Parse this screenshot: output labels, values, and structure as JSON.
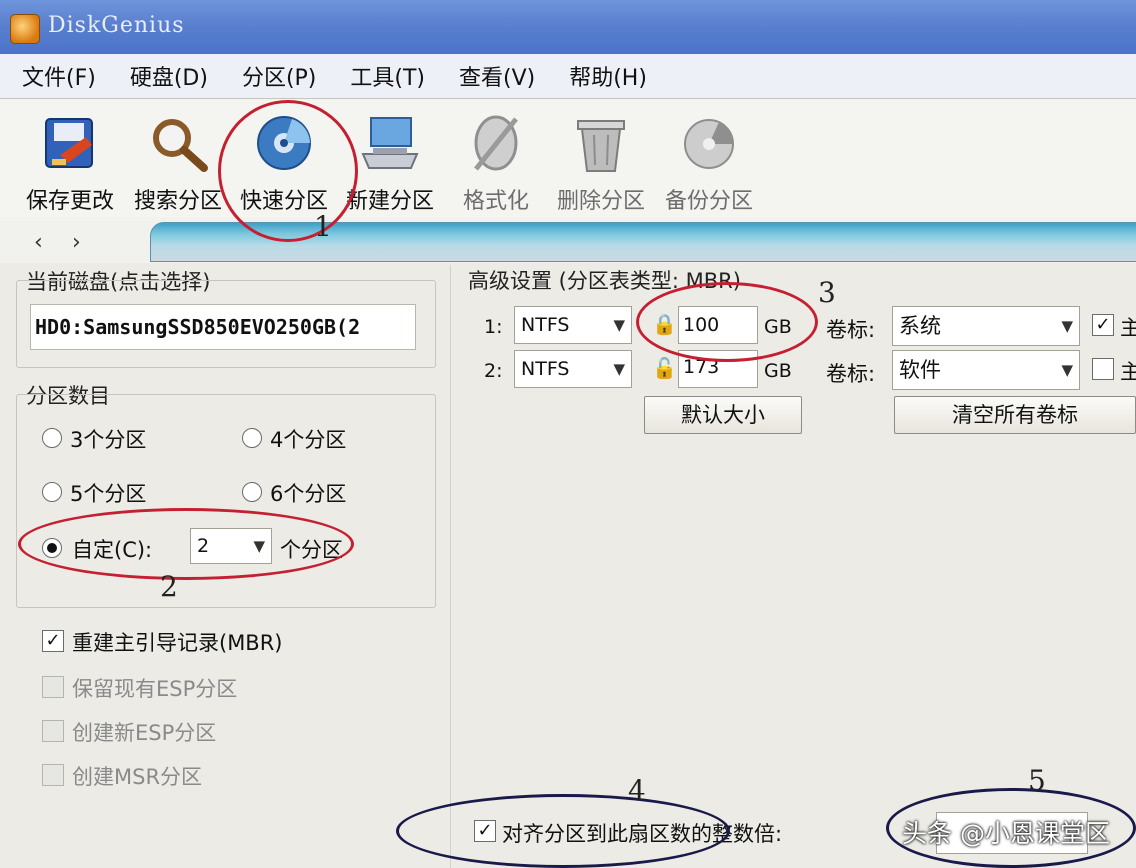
{
  "window": {
    "title": "DiskGenius"
  },
  "menu": [
    {
      "label": "文件(F)"
    },
    {
      "label": "硬盘(D)"
    },
    {
      "label": "分区(P)"
    },
    {
      "label": "工具(T)"
    },
    {
      "label": "查看(V)"
    },
    {
      "label": "帮助(H)"
    }
  ],
  "toolbar": [
    {
      "label": "保存更改",
      "icon": "save-icon"
    },
    {
      "label": "搜索分区",
      "icon": "search-icon"
    },
    {
      "label": "快速分区",
      "icon": "quick-partition-icon"
    },
    {
      "label": "新建分区",
      "icon": "new-partition-icon"
    },
    {
      "label": "格式化",
      "icon": "format-icon"
    },
    {
      "label": "删除分区",
      "icon": "delete-icon"
    },
    {
      "label": "备份分区",
      "icon": "backup-icon"
    }
  ],
  "nav": {
    "back": "‹",
    "forward": "›"
  },
  "left": {
    "disk_group_title": "当前磁盘(点击选择)",
    "disk_value": "HD0:SamsungSSD850EVO250GB(2",
    "count_group_title": "分区数目",
    "radios": [
      {
        "label": "3个分区",
        "checked": false
      },
      {
        "label": "4个分区",
        "checked": false
      },
      {
        "label": "5个分区",
        "checked": false
      },
      {
        "label": "6个分区",
        "checked": false
      }
    ],
    "custom_label": "自定(C):",
    "custom_value": "2",
    "custom_suffix": "个分区",
    "checkboxes": [
      {
        "label": "重建主引导记录(MBR)",
        "checked": true,
        "enabled": true
      },
      {
        "label": "保留现有ESP分区",
        "checked": false,
        "enabled": false
      },
      {
        "label": "创建新ESP分区",
        "checked": false,
        "enabled": false
      },
      {
        "label": "创建MSR分区",
        "checked": false,
        "enabled": false
      }
    ]
  },
  "right": {
    "group_title": "高级设置 (分区表类型: MBR)",
    "rows": [
      {
        "index": "1:",
        "fs": "NTFS",
        "size": "100",
        "unit": "GB",
        "vol_label": "卷标:",
        "volume": "系统",
        "primary_checked": true
      },
      {
        "index": "2:",
        "fs": "NTFS",
        "size": "173",
        "unit": "GB",
        "vol_label": "卷标:",
        "volume": "软件",
        "primary_checked": false
      }
    ],
    "primary_label": "主",
    "default_size_button": "默认大小",
    "clear_labels_button": "清空所有卷标",
    "align_label": "对齐分区到此扇区数的整数倍:",
    "align_checked": true
  },
  "annotations": [
    "1",
    "2",
    "3",
    "4",
    "5"
  ],
  "watermark": "头条 @小恩课堂区"
}
